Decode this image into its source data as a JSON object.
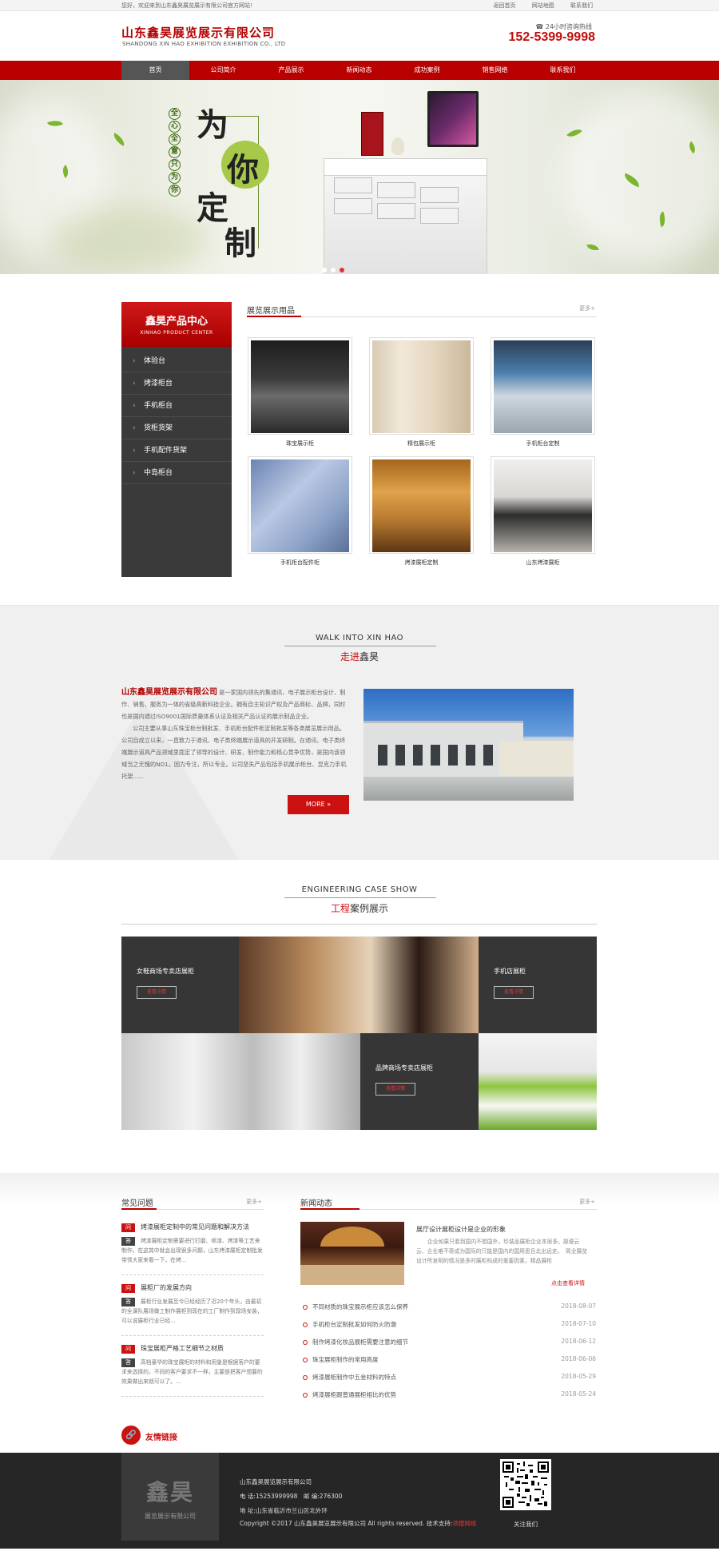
{
  "topbar": {
    "welcome": "您好，欢迎来到山东鑫昊展览展示有限公司官方网站!",
    "links": [
      "返回首页",
      "网站地图",
      "联系我们"
    ]
  },
  "header": {
    "logo_cn": "山东鑫昊展览展示有限公司",
    "logo_en": "SHANDONG XIN HAO EXHIBITION EXHIBITION CO., LTD",
    "hotline_label": "☎ 24小时咨询热线",
    "phone": "152-5399-9998"
  },
  "nav": [
    "首页",
    "公司简介",
    "产品展示",
    "新闻动态",
    "成功案例",
    "销售网络",
    "联系我们"
  ],
  "banner": {
    "big": [
      "为",
      "你",
      "定",
      "制"
    ],
    "small": [
      "全",
      "心",
      "全",
      "意",
      "只",
      "为",
      "你"
    ]
  },
  "sidebar": {
    "title": "鑫昊产品中心",
    "subtitle": "XINHAO PRODUCT CENTER",
    "items": [
      "体验台",
      "烤漆柜台",
      "手机柜台",
      "货柜货架",
      "手机配件货架",
      "中岛柜台"
    ]
  },
  "products": {
    "title": "展览展示用品",
    "more": "更多+",
    "items": [
      "珠宝展示柜",
      "精包展示柜",
      "手机柜台定制",
      "手机柜台配件柜",
      "烤漆展柜定制",
      "山东烤漆展柜"
    ]
  },
  "about": {
    "title_en": "WALK INTO XIN HAO",
    "title_cn_red": "走进",
    "title_cn": "鑫昊",
    "company": "山东鑫昊展览展示有限公司",
    "p1": "是一家国内领先的集通讯、电子展示柜台设计、制作、销售、服务为一体的省级高新科技企业。拥有自主知识产权及产品商标、品牌，同时也是国内通过ISO9001国际质量体系认证及相关产品认证的展示制品企业。",
    "p2": "公司主要从事山东珠宝柜台制批发、手机柜台配件柜定制批发等各类展览展示用品。公司自成立以来，一直致力于通讯、电子类终端展示道具的开发研制。在通讯、电子类终端展示道具产品领域里面定了领导的设计、研发、制作能力和核心竞争优势，是国内该领域当之无愧的NO1。因为专注，所以专业。公司坚失产品包括手机展示柜台、显克力手机托架......",
    "more": "MORE »"
  },
  "cases": {
    "title_en": "ENGINEERING CASE SHOW",
    "title_cn_red": "工程",
    "title_cn": "案例展示",
    "items": [
      {
        "title": "女鞋商场专卖店展柜",
        "btn": "查看详情"
      },
      {
        "title": "手机店展柜",
        "btn": "查看详情"
      },
      {
        "title": "品牌商场专卖店展柜",
        "btn": "查看详情"
      }
    ]
  },
  "faq": {
    "title": "常见问题",
    "more": "更多+",
    "items": [
      {
        "q": "烤漆展柜定制中的常见问题和解决方法",
        "a": "烤漆展柜定制需要进行打磨、喷漆、烤漆等工艺来制作。在这其中就会出现很多问题，山东烤漆展柜定制批发带领大家来看一下，在烤..."
      },
      {
        "q": "展柜厂的发展方向",
        "a": "展柜行业发展至今已经经历了近20个年头，由最初的全课队展场做工制作展柜到现在的工厂制作到现场安装，可以说展柜行业已经..."
      },
      {
        "q": "珠宝展柜严格工艺细节之材质",
        "a": "高档豪华的珠宝展柜的材料和用量是根据客户的要求来选择的。不同的客户要求不一样，主要是把客户想要的效果做出来就可以了。..."
      }
    ]
  },
  "news": {
    "title": "新闻动态",
    "more": "更多+",
    "featured": {
      "title": "展厅设计展柜设计是企业的形象",
      "desc": "企业如果只看到国内不想国外，珍装品展柜企业本很多。部便云云、企业难不奇成为国际的只能是国内的国用思且北出远走。　简业展览设计所发明的情况是多时展柜构成的重要因素，精品展柜",
      "more": "点击查看详情"
    },
    "items": [
      {
        "title": "不同材质的珠宝展示柜应该怎么保养",
        "date": "2018-08-07"
      },
      {
        "title": "手机柜台定制批发如何防火防潮",
        "date": "2018-07-10"
      },
      {
        "title": "制作烤漆化妆品展柜需要注意的细节",
        "date": "2018-06-12"
      },
      {
        "title": "珠宝展柜制作的常用高度",
        "date": "2018-06-06"
      },
      {
        "title": "烤漆展柜制作中五金材料的特点",
        "date": "2018-05-29"
      },
      {
        "title": "烤漆展柜跟普通展柜相比的优势",
        "date": "2018-05-24"
      }
    ]
  },
  "friend_links": {
    "icon": "🔗",
    "title": "友情链接"
  },
  "footer": {
    "logo": "鑫昊",
    "logo_sub": "展览展示有限公司",
    "company": "山东鑫昊展览展示有限公司",
    "phone": "电 话:15253999998　邮 编:276300",
    "address": "地 址:山东省临沂市兰山区北外环",
    "copyright": "Copyright ©2017 山东鑫昊展览展示有限公司 All rights reserved. 技术支持:",
    "tech": "领搜网络",
    "qr_caption": "关注我们"
  }
}
